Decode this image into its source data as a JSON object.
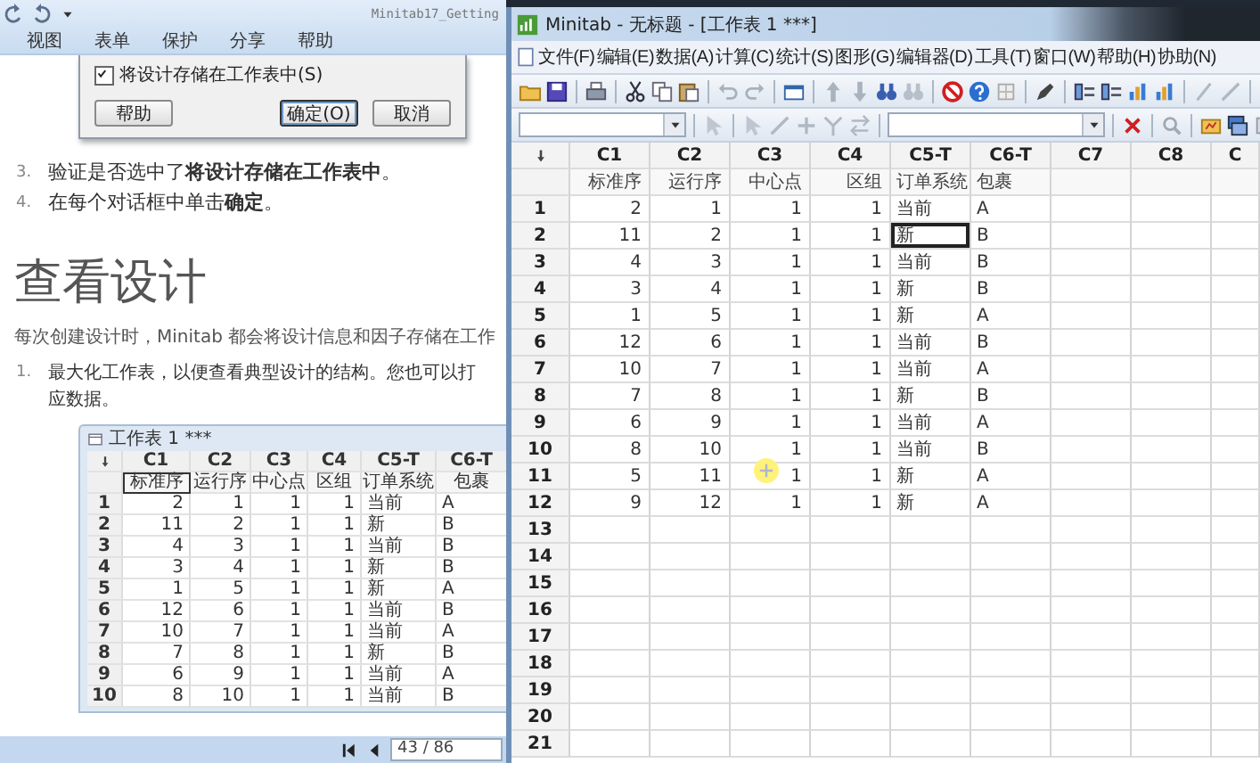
{
  "doc_viewer": {
    "title": "Minitab17_Getting",
    "menu": [
      "视图",
      "表单",
      "保护",
      "分享",
      "帮助"
    ],
    "dialog": {
      "checkbox": {
        "label": "将设计存储在工作表中(S)",
        "checked": true
      },
      "buttons": [
        {
          "label": "帮助",
          "default": false
        },
        {
          "label": "确定(O)",
          "default": true
        },
        {
          "label": "取消",
          "default": false
        }
      ]
    },
    "steps": [
      {
        "number": "3.",
        "text": "验证是否选中了**将设计存储在工作表中**。"
      },
      {
        "number": "4.",
        "text": "在每个对话框中单击**确定**。"
      }
    ],
    "heading": "查看设计",
    "intro": "每次创建设计时，Minitab 都会将设计信息和因子存储在工作",
    "list": [
      {
        "number": "1.",
        "lines": [
          "最大化工作表，以便查看典型设计的结构。您也可以打",
          "应数据。"
        ]
      }
    ],
    "figure": {
      "title": "工作表 1 ***",
      "columns": [
        {
          "id": "C1",
          "name": "标准序",
          "kind": "numeric",
          "selected": true
        },
        {
          "id": "C2",
          "name": "运行序",
          "kind": "numeric",
          "selected": false
        },
        {
          "id": "C3",
          "name": "中心点",
          "kind": "numeric",
          "selected": false
        },
        {
          "id": "C4",
          "name": "区组",
          "kind": "numeric",
          "selected": false
        },
        {
          "id": "C5-T",
          "name": "订单系统",
          "kind": "text",
          "selected": false
        },
        {
          "id": "C6-T",
          "name": "包裹",
          "kind": "text",
          "selected": false
        }
      ],
      "rows": [
        {
          "number": "1",
          "cells": [
            "2",
            "1",
            "1",
            "1",
            "当前",
            "A"
          ]
        },
        {
          "number": "2",
          "cells": [
            "11",
            "2",
            "1",
            "1",
            "新",
            "B"
          ]
        },
        {
          "number": "3",
          "cells": [
            "4",
            "3",
            "1",
            "1",
            "当前",
            "B"
          ]
        },
        {
          "number": "4",
          "cells": [
            "3",
            "4",
            "1",
            "1",
            "新",
            "B"
          ]
        },
        {
          "number": "5",
          "cells": [
            "1",
            "5",
            "1",
            "1",
            "新",
            "A"
          ]
        },
        {
          "number": "6",
          "cells": [
            "12",
            "6",
            "1",
            "1",
            "当前",
            "B"
          ]
        },
        {
          "number": "7",
          "cells": [
            "10",
            "7",
            "1",
            "1",
            "当前",
            "A"
          ]
        },
        {
          "number": "8",
          "cells": [
            "7",
            "8",
            "1",
            "1",
            "新",
            "B"
          ]
        },
        {
          "number": "9",
          "cells": [
            "6",
            "9",
            "1",
            "1",
            "当前",
            "A"
          ]
        },
        {
          "number": "10",
          "cells": [
            "8",
            "10",
            "1",
            "1",
            "当前",
            "B"
          ]
        }
      ]
    },
    "page_indicator": "43 / 86"
  },
  "minitab_window": {
    "title": "Minitab - 无标题 - [工作表 1 ***]",
    "menu": [
      "文件(F)",
      "编辑(E)",
      "数据(A)",
      "计算(C)",
      "统计(S)",
      "图形(G)",
      "编辑器(D)",
      "工具(T)",
      "窗口(W)",
      "帮助(H)",
      "协助(N)"
    ],
    "worksheet": {
      "columns": [
        {
          "id": "C1",
          "name": "标准序",
          "kind": "numeric"
        },
        {
          "id": "C2",
          "name": "运行序",
          "kind": "numeric"
        },
        {
          "id": "C3",
          "name": "中心点",
          "kind": "numeric"
        },
        {
          "id": "C4",
          "name": "区组",
          "kind": "numeric"
        },
        {
          "id": "C5-T",
          "name": "订单系统",
          "kind": "text"
        },
        {
          "id": "C6-T",
          "name": "包裹",
          "kind": "text"
        },
        {
          "id": "C7",
          "kind": "empty"
        },
        {
          "id": "C8",
          "kind": "empty"
        },
        {
          "id": "C",
          "kind": "empty"
        }
      ],
      "rows": [
        {
          "number": "1",
          "cells": [
            {
              "value": "2",
              "selected": false
            },
            {
              "value": "1",
              "selected": false
            },
            {
              "value": "1",
              "selected": false
            },
            {
              "value": "1",
              "selected": false
            },
            {
              "value": "当前",
              "selected": false
            },
            {
              "value": "A",
              "selected": false
            }
          ]
        },
        {
          "number": "2",
          "cells": [
            {
              "value": "11",
              "selected": false
            },
            {
              "value": "2",
              "selected": false
            },
            {
              "value": "1",
              "selected": false
            },
            {
              "value": "1",
              "selected": false
            },
            {
              "value": "新",
              "selected": true
            },
            {
              "value": "B",
              "selected": false
            }
          ]
        },
        {
          "number": "3",
          "cells": [
            {
              "value": "4",
              "selected": false
            },
            {
              "value": "3",
              "selected": false
            },
            {
              "value": "1",
              "selected": false
            },
            {
              "value": "1",
              "selected": false
            },
            {
              "value": "当前",
              "selected": false
            },
            {
              "value": "B",
              "selected": false
            }
          ]
        },
        {
          "number": "4",
          "cells": [
            {
              "value": "3",
              "selected": false
            },
            {
              "value": "4",
              "selected": false
            },
            {
              "value": "1",
              "selected": false
            },
            {
              "value": "1",
              "selected": false
            },
            {
              "value": "新",
              "selected": false
            },
            {
              "value": "B",
              "selected": false
            }
          ]
        },
        {
          "number": "5",
          "cells": [
            {
              "value": "1",
              "selected": false
            },
            {
              "value": "5",
              "selected": false
            },
            {
              "value": "1",
              "selected": false
            },
            {
              "value": "1",
              "selected": false
            },
            {
              "value": "新",
              "selected": false
            },
            {
              "value": "A",
              "selected": false
            }
          ]
        },
        {
          "number": "6",
          "cells": [
            {
              "value": "12",
              "selected": false
            },
            {
              "value": "6",
              "selected": false
            },
            {
              "value": "1",
              "selected": false
            },
            {
              "value": "1",
              "selected": false
            },
            {
              "value": "当前",
              "selected": false
            },
            {
              "value": "B",
              "selected": false
            }
          ]
        },
        {
          "number": "7",
          "cells": [
            {
              "value": "10",
              "selected": false
            },
            {
              "value": "7",
              "selected": false
            },
            {
              "value": "1",
              "selected": false
            },
            {
              "value": "1",
              "selected": false
            },
            {
              "value": "当前",
              "selected": false
            },
            {
              "value": "A",
              "selected": false
            }
          ]
        },
        {
          "number": "8",
          "cells": [
            {
              "value": "7",
              "selected": false
            },
            {
              "value": "8",
              "selected": false
            },
            {
              "value": "1",
              "selected": false
            },
            {
              "value": "1",
              "selected": false
            },
            {
              "value": "新",
              "selected": false
            },
            {
              "value": "B",
              "selected": false
            }
          ]
        },
        {
          "number": "9",
          "cells": [
            {
              "value": "6",
              "selected": false
            },
            {
              "value": "9",
              "selected": false
            },
            {
              "value": "1",
              "selected": false
            },
            {
              "value": "1",
              "selected": false
            },
            {
              "value": "当前",
              "selected": false
            },
            {
              "value": "A",
              "selected": false
            }
          ]
        },
        {
          "number": "10",
          "cells": [
            {
              "value": "8",
              "selected": false
            },
            {
              "value": "10",
              "selected": false
            },
            {
              "value": "1",
              "selected": false
            },
            {
              "value": "1",
              "selected": false
            },
            {
              "value": "当前",
              "selected": false
            },
            {
              "value": "B",
              "selected": false
            }
          ]
        },
        {
          "number": "11",
          "cells": [
            {
              "value": "5",
              "selected": false
            },
            {
              "value": "11",
              "selected": false
            },
            {
              "value": "1",
              "selected": false
            },
            {
              "value": "1",
              "selected": false
            },
            {
              "value": "新",
              "selected": false
            },
            {
              "value": "A",
              "selected": false
            }
          ]
        },
        {
          "number": "12",
          "cells": [
            {
              "value": "9",
              "selected": false
            },
            {
              "value": "12",
              "selected": false
            },
            {
              "value": "1",
              "selected": false
            },
            {
              "value": "1",
              "selected": false
            },
            {
              "value": "新",
              "selected": false
            },
            {
              "value": "A",
              "selected": false
            }
          ]
        },
        {
          "number": "13"
        },
        {
          "number": "14"
        },
        {
          "number": "15"
        },
        {
          "number": "16"
        },
        {
          "number": "17"
        },
        {
          "number": "18"
        },
        {
          "number": "19"
        },
        {
          "number": "20"
        },
        {
          "number": "21"
        }
      ]
    }
  }
}
